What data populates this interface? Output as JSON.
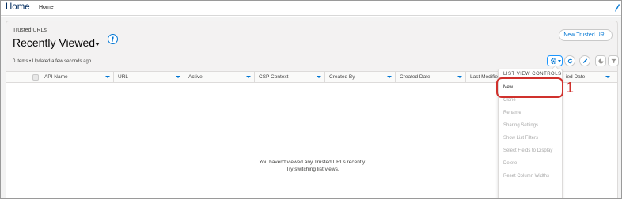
{
  "topbar": {
    "app_title": "Home",
    "nav_home": "Home",
    "edit_icon": "pencil-icon"
  },
  "header": {
    "object_label": "Trusted URLs",
    "view_title": "Recently Viewed",
    "new_button": "New Trusted URL",
    "status": "0 items • Updated a few seconds ago"
  },
  "toolbar": {
    "gear_icon": "gear-icon",
    "refresh_icon": "refresh-icon",
    "edit_icon": "pencil-icon",
    "chart_icon": "chart-icon",
    "filter_icon": "filter-icon"
  },
  "table": {
    "columns": [
      "API Name",
      "URL",
      "Active",
      "CSP Context",
      "Created By",
      "Created Date",
      "Last Modified",
      "ied Date"
    ],
    "empty_line1": "You haven't viewed any Trusted URLs recently.",
    "empty_line2": "Try switching list views."
  },
  "menu": {
    "header": "LIST VIEW CONTROLS",
    "items": [
      "New",
      "Clone",
      "Rename",
      "Sharing Settings",
      "Show List Filters",
      "Select Fields to Display",
      "Delete",
      "Reset Column Widths"
    ]
  },
  "annotation": {
    "callout_number": "1"
  },
  "colors": {
    "brand_blue": "#0176d3",
    "app_title": "#032d60",
    "highlight_red": "#d0312d",
    "disabled_text": "#a8a8a8"
  }
}
